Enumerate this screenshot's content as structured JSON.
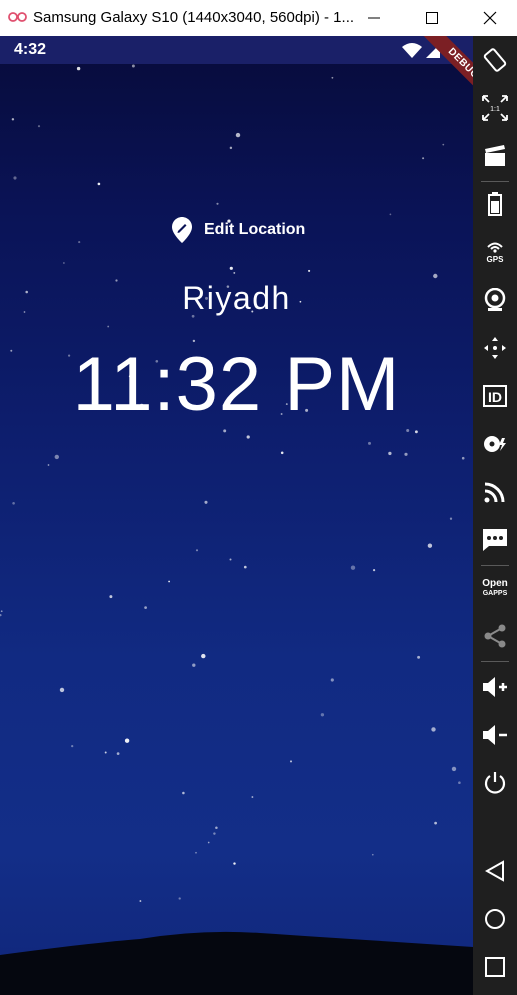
{
  "window": {
    "title": "Samsung Galaxy S10 (1440x3040, 560dpi) - 1...",
    "icon": "oo-link-icon"
  },
  "statusbar": {
    "time": "4:32",
    "icons": [
      "wifi-icon",
      "signal-icon",
      "battery-icon"
    ],
    "debug_label": "DEBUG"
  },
  "app": {
    "edit_location_label": "Edit Location",
    "city": "Riyadh",
    "time": "11:32 PM"
  },
  "toolbar": {
    "items": [
      "rotate-icon",
      "one-to-one-icon",
      "screen-record-icon",
      "battery-icon",
      "gps-icon",
      "camera-icon",
      "dpad-icon",
      "id-icon",
      "disk-icon",
      "rss-icon",
      "sms-icon",
      "opengapps-icon",
      "share-icon",
      "volume-up-icon",
      "volume-down-icon",
      "power-icon",
      "back-icon",
      "home-icon",
      "recents-icon"
    ],
    "gps_label": "GPS",
    "id_label": "ID",
    "open_label": "Open",
    "gapps_label": "GAPPS",
    "one_to_one_label": "1:1"
  },
  "colors": {
    "sky_top": "#070b3a",
    "sky_bottom": "#132e88",
    "statusbar": "#1a2068",
    "toolbar": "#1f1f1f",
    "debug_ribbon": "#7b1f24"
  }
}
